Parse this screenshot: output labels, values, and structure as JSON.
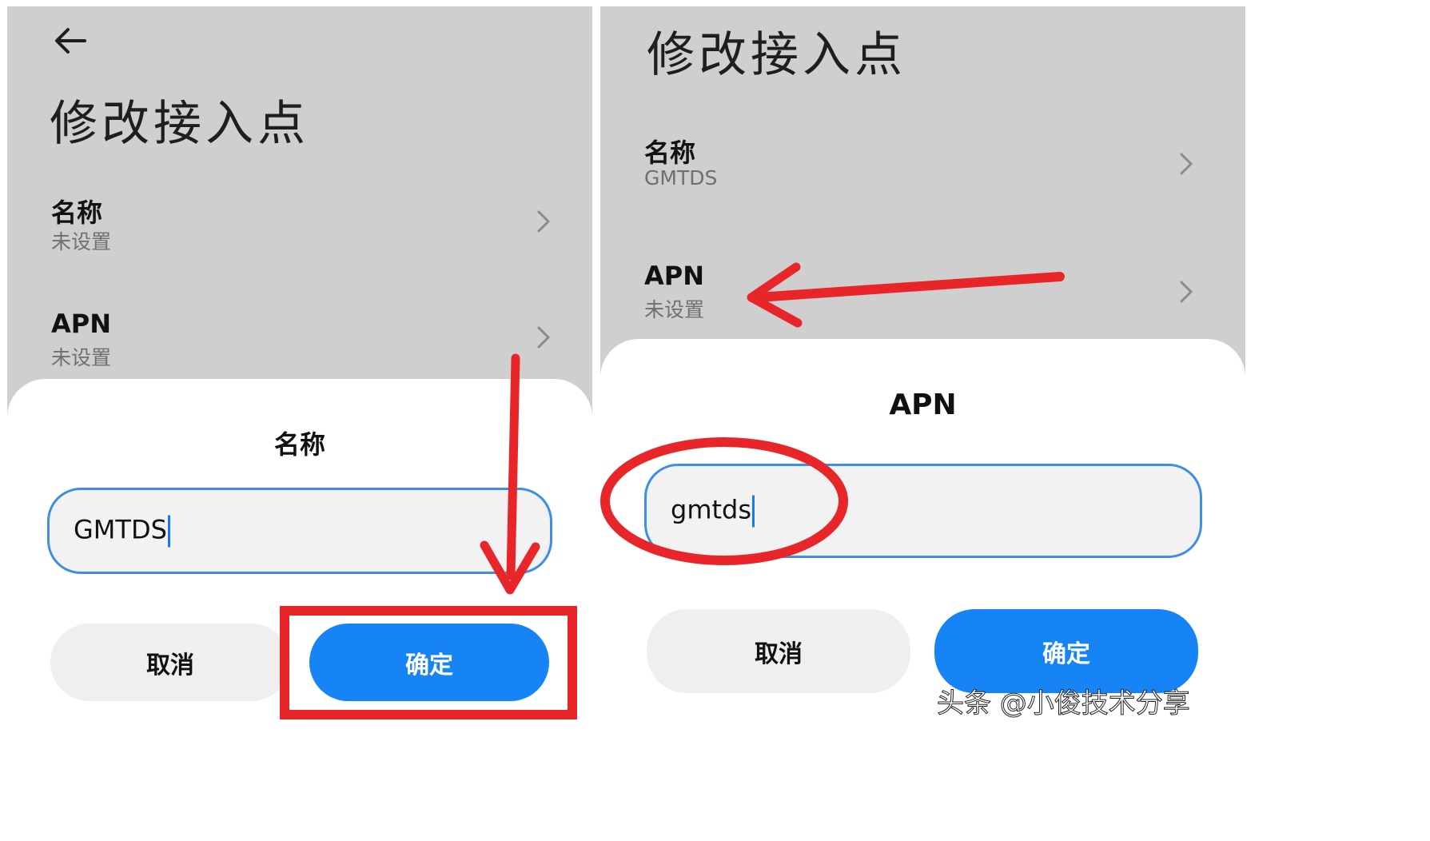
{
  "left_screen": {
    "title": "修改接入点",
    "rows": [
      {
        "label": "名称",
        "value": "未设置"
      },
      {
        "label": "APN",
        "value": "未设置"
      }
    ],
    "dialog": {
      "title": "名称",
      "input_value": "GMTDS",
      "cancel_label": "取消",
      "confirm_label": "确定"
    }
  },
  "right_screen": {
    "title": "修改接入点",
    "rows": [
      {
        "label": "名称",
        "value": "GMTDS"
      },
      {
        "label": "APN",
        "value": "未设置"
      }
    ],
    "dialog": {
      "title": "APN",
      "input_value": "gmtds",
      "cancel_label": "取消",
      "confirm_label": "确定"
    }
  },
  "annotation_color": "#e8262a",
  "accent_color": "#1684f5",
  "watermark": "头条 @小俊技术分享"
}
